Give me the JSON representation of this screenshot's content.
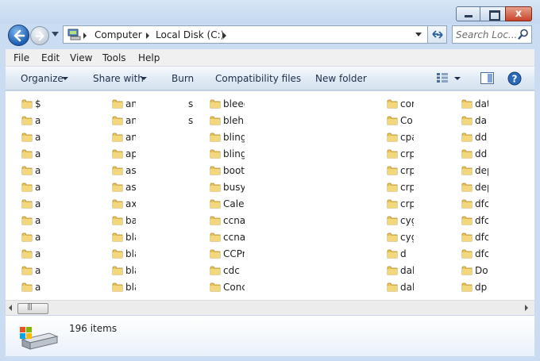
{
  "window": {
    "caption_buttons": [
      "minimize",
      "maximize",
      "close"
    ],
    "close_glyph": "x"
  },
  "nav": {
    "breadcrumbs": [
      "Computer",
      "Local Disk (C:)"
    ],
    "search_placeholder": "Search Loc..."
  },
  "menu": [
    "File",
    "Edit",
    "View",
    "Tools",
    "Help"
  ],
  "toolbar": {
    "organize": "Organize",
    "share_with": "Share with",
    "burn": "Burn",
    "compatibility": "Compatibility files",
    "new_folder": "New folder"
  },
  "columns": [
    [
      "$",
      "a",
      "a",
      "a",
      "a",
      "a",
      "a",
      "a",
      "a",
      "a",
      "a",
      "a"
    ],
    [
      "an",
      "an",
      "an",
      "ap",
      "as",
      "as",
      "ax",
      "ba",
      "bla",
      "bla",
      "bla",
      "bla"
    ],
    [
      "bleee",
      "bleh",
      "bling",
      "bling",
      "boot",
      "busyb",
      "Calen",
      "ccnar",
      "ccnat",
      "CCPr",
      "cdc",
      "Conc"
    ],
    [
      "cor",
      "Co",
      "cpa",
      "crp",
      "crp",
      "crp",
      "crp",
      "cyg",
      "cyg",
      "d",
      "dal",
      "dal"
    ],
    [
      "dat",
      "da",
      "dd",
      "dd",
      "dep",
      "dep",
      "dfc",
      "dfc",
      "dfc",
      "dfc",
      "Do",
      "dp"
    ]
  ],
  "stray_text": [
    "s",
    "s"
  ],
  "status": {
    "item_count": "196 items"
  },
  "colors": {
    "accent": "#1f5fb2",
    "folder": "#e8c35a",
    "window_frame": "#c9dcf1"
  }
}
